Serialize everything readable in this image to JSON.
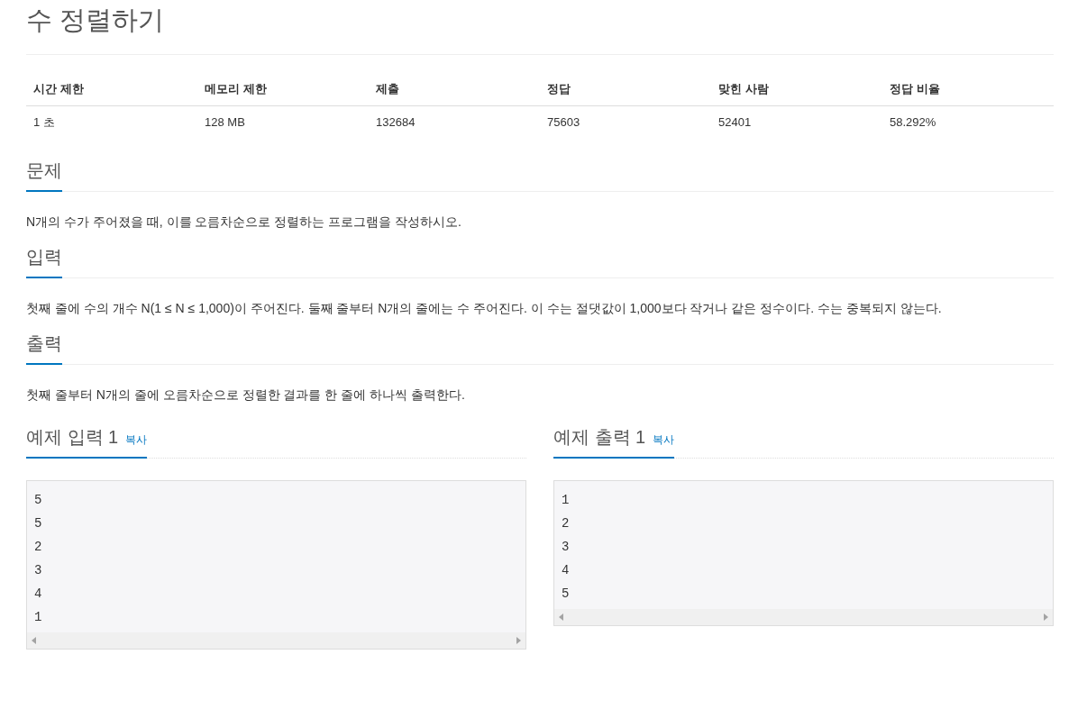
{
  "title": "수 정렬하기",
  "stats": {
    "columns": [
      "시간 제한",
      "메모리 제한",
      "제출",
      "정답",
      "맞힌 사람",
      "정답 비율"
    ],
    "values": [
      "1 초",
      "128 MB",
      "132684",
      "75603",
      "52401",
      "58.292%"
    ]
  },
  "sections": [
    {
      "heading": "문제",
      "text": "N개의 수가 주어졌을 때, 이를 오름차순으로 정렬하는 프로그램을 작성하시오."
    },
    {
      "heading": "입력",
      "text": "첫째 줄에 수의 개수 N(1 ≤ N ≤ 1,000)이 주어진다. 둘째 줄부터 N개의 줄에는 수 주어진다. 이 수는 절댓값이 1,000보다 작거나 같은 정수이다. 수는 중복되지 않는다."
    },
    {
      "heading": "출력",
      "text": "첫째 줄부터 N개의 줄에 오름차순으로 정렬한 결과를 한 줄에 하나씩 출력한다."
    }
  ],
  "samples": [
    {
      "title": "예제 입력 1",
      "copy": "복사",
      "lines": [
        "5",
        "5",
        "2",
        "3",
        "4",
        "1"
      ]
    },
    {
      "title": "예제 출력 1",
      "copy": "복사",
      "lines": [
        "1",
        "2",
        "3",
        "4",
        "5"
      ]
    }
  ]
}
